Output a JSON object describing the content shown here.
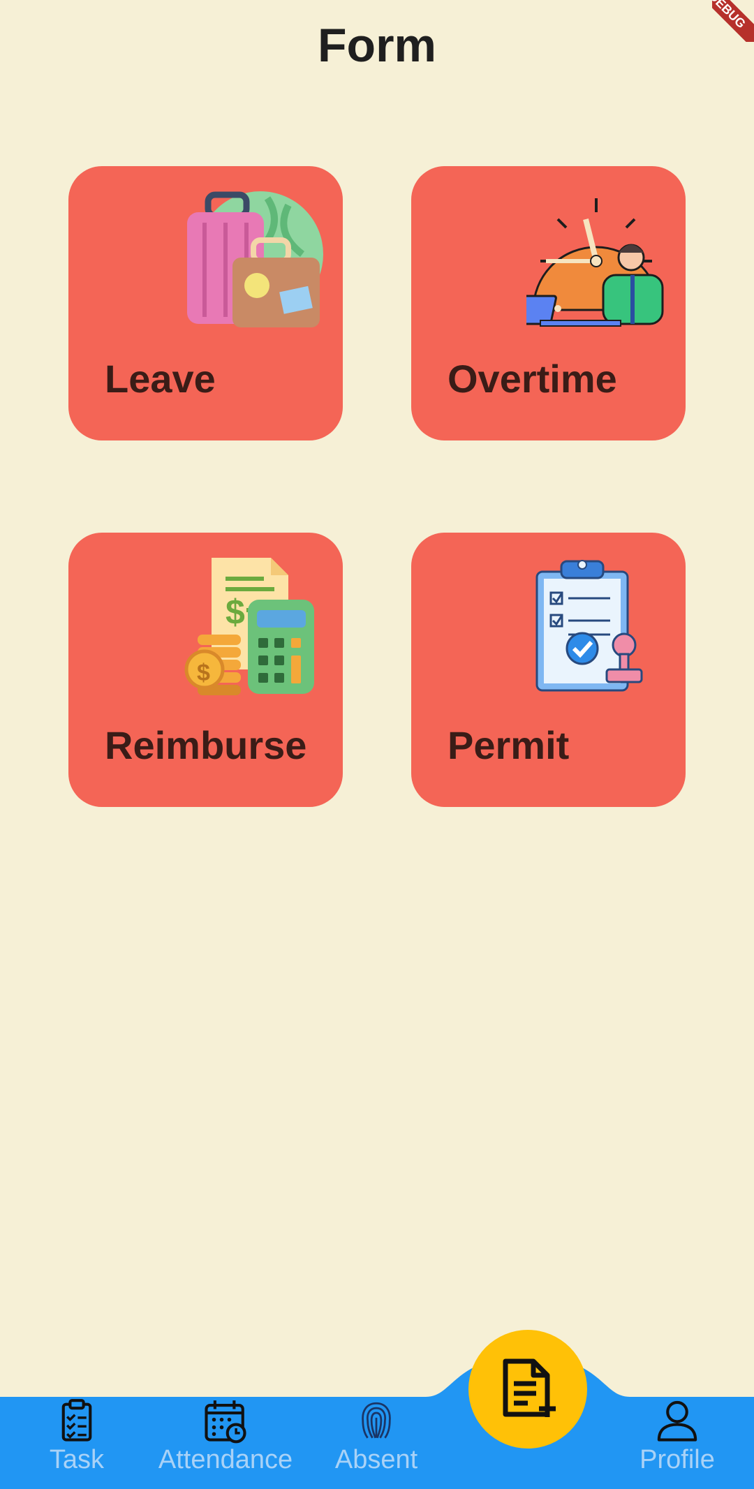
{
  "header": {
    "title": "Form",
    "debug_banner": "DEBUG"
  },
  "cards": [
    {
      "label": "Leave",
      "icon": "luggage-icon"
    },
    {
      "label": "Overtime",
      "icon": "clock-worker-icon"
    },
    {
      "label": "Reimburse",
      "icon": "receipt-calculator-icon"
    },
    {
      "label": "Permit",
      "icon": "clipboard-stamp-icon"
    }
  ],
  "bottom_nav": {
    "items": [
      {
        "label": "Task",
        "icon": "clipboard-check-icon"
      },
      {
        "label": "Attendance",
        "icon": "calendar-clock-icon"
      },
      {
        "label": "Absent",
        "icon": "fingerprint-icon"
      },
      {
        "label": "Profile",
        "icon": "user-icon"
      }
    ],
    "center_button": {
      "icon": "document-add-icon",
      "active": true
    }
  },
  "colors": {
    "background": "#F6F0D6",
    "card": "#F46556",
    "card_text": "#3A1C17",
    "nav_bar": "#2196F3",
    "nav_label": "#A9D2F7",
    "fab": "#FFC107"
  }
}
